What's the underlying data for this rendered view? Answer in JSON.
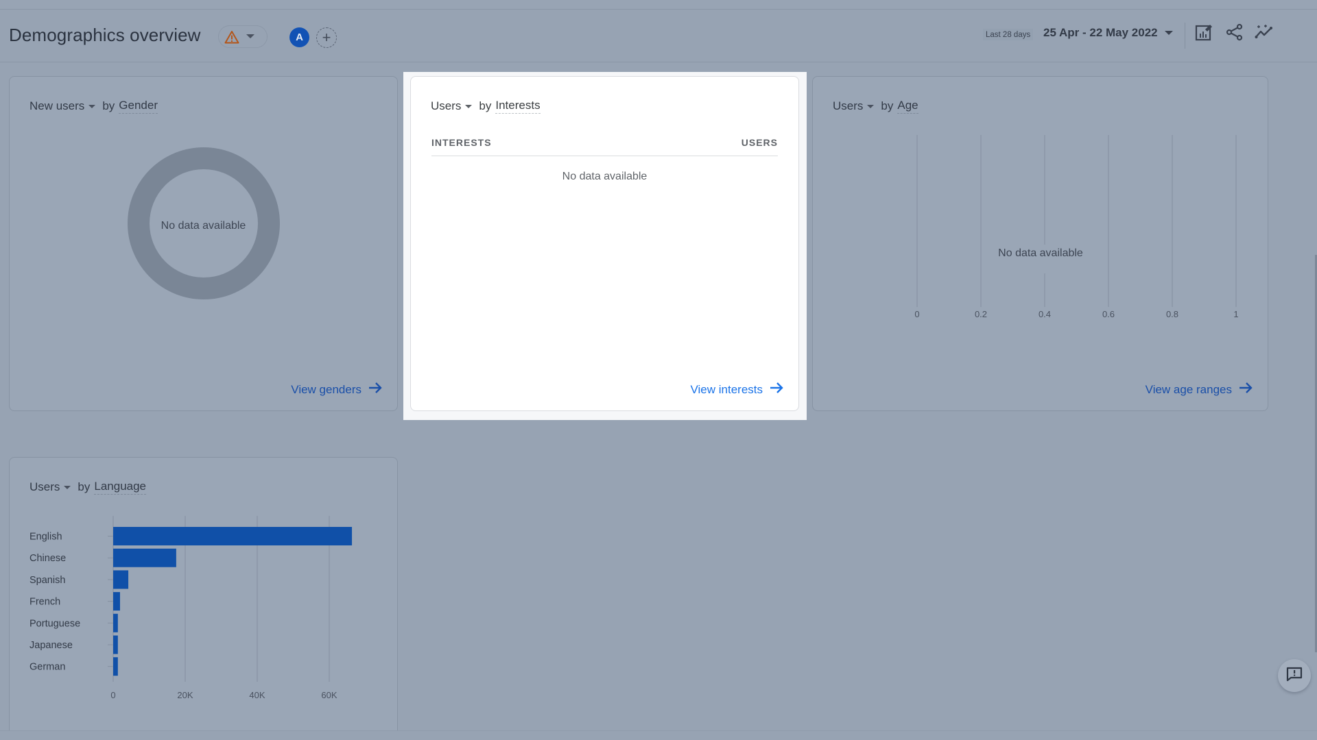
{
  "header": {
    "title": "Demographics overview",
    "warning_icon": "warning-triangle-icon",
    "avatar_letter": "A",
    "add_comparison_icon": "plus-icon",
    "date_preset": "Last 28 days",
    "date_range": "25 Apr - 22 May 2022",
    "actions": [
      {
        "name": "customize-report",
        "icon": "edit-chart-icon"
      },
      {
        "name": "share",
        "icon": "share-icon"
      },
      {
        "name": "insights",
        "icon": "insights-sparkline-icon"
      }
    ]
  },
  "colors": {
    "accent_blue": "#1252b4",
    "link_blue": "#1a73e8",
    "warning_orange": "#b3561a",
    "bar_blue": "#1050a8"
  },
  "cards": {
    "gender": {
      "metric": "New users",
      "by": "by",
      "dimension": "Gender",
      "no_data": "No data available",
      "link": "View genders"
    },
    "interests": {
      "metric": "Users",
      "by": "by",
      "dimension": "Interests",
      "columns": [
        "INTERESTS",
        "USERS"
      ],
      "no_data": "No data available",
      "link": "View interests"
    },
    "age": {
      "metric": "Users",
      "by": "by",
      "dimension": "Age",
      "no_data": "No data available",
      "link": "View age ranges"
    },
    "language": {
      "metric": "Users",
      "by": "by",
      "dimension": "Language"
    }
  },
  "chart_data": [
    {
      "id": "gender",
      "type": "pie",
      "title": "New users by Gender",
      "values": [],
      "annotation": "No data available"
    },
    {
      "id": "age",
      "type": "bar",
      "title": "Users by Age",
      "orientation": "horizontal",
      "categories": [],
      "values": [],
      "xlim": [
        0,
        1
      ],
      "xticks": [
        "0",
        "0.2",
        "0.4",
        "0.6",
        "0.8",
        "1"
      ],
      "xtick_values": [
        0,
        0.2,
        0.4,
        0.6,
        0.8,
        1
      ],
      "grid": true,
      "annotation": "No data available"
    },
    {
      "id": "language",
      "type": "bar",
      "title": "Users by Language",
      "orientation": "horizontal",
      "categories": [
        "English",
        "Chinese",
        "Spanish",
        "French",
        "Portuguese",
        "Japanese",
        "German"
      ],
      "values": [
        66300,
        17500,
        4200,
        1900,
        1300,
        1300,
        1300
      ],
      "xlim": [
        0,
        70000
      ],
      "xticks": [
        "0",
        "20K",
        "40K",
        "60K"
      ],
      "xtick_values": [
        0,
        20000,
        40000,
        60000
      ],
      "grid": true,
      "xlabel": "",
      "ylabel": ""
    }
  ],
  "feedback": {
    "icon": "feedback-icon"
  }
}
